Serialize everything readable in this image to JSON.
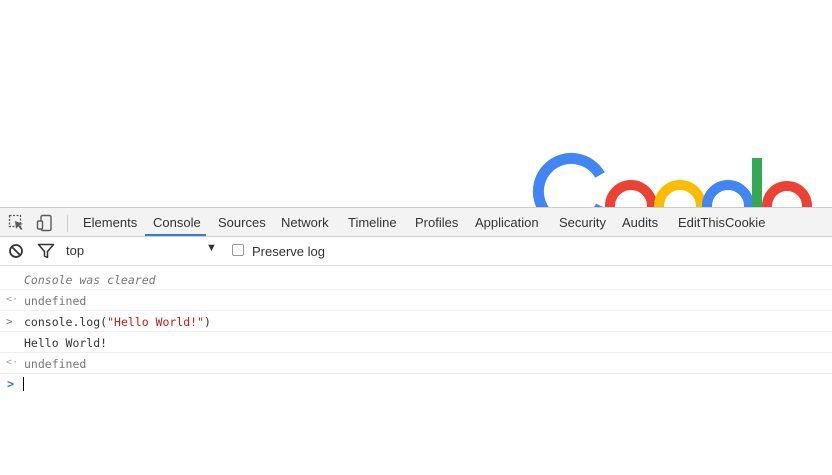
{
  "page": {
    "logo_text": "Google"
  },
  "devtools": {
    "tabs": [
      {
        "label": "Elements"
      },
      {
        "label": "Console",
        "active": true
      },
      {
        "label": "Sources"
      },
      {
        "label": "Network"
      },
      {
        "label": "Timeline"
      },
      {
        "label": "Profiles"
      },
      {
        "label": "Application"
      },
      {
        "label": "Security"
      },
      {
        "label": "Audits"
      },
      {
        "label": "EditThisCookie"
      }
    ],
    "left_icons": [
      "inspect-element-icon",
      "device-toolbar-icon"
    ],
    "console_toolbar": {
      "clear_icon": "clear-console-icon",
      "filter_icon": "filter-icon",
      "context": "top",
      "preserve_log_label": "Preserve log",
      "preserve_log_checked": false
    },
    "messages": [
      {
        "kind": "info",
        "text": "Console was cleared"
      },
      {
        "kind": "result",
        "gutter": "<·",
        "text": "undefined"
      },
      {
        "kind": "input",
        "gutter": ">",
        "code_prefix": "console.log(",
        "code_string": "\"Hello World!\"",
        "code_suffix": ")"
      },
      {
        "kind": "log",
        "text": "Hello World!"
      },
      {
        "kind": "result",
        "gutter": "<·",
        "text": "undefined"
      }
    ],
    "prompt_symbol": ">",
    "accent_color": "#3879d9"
  }
}
